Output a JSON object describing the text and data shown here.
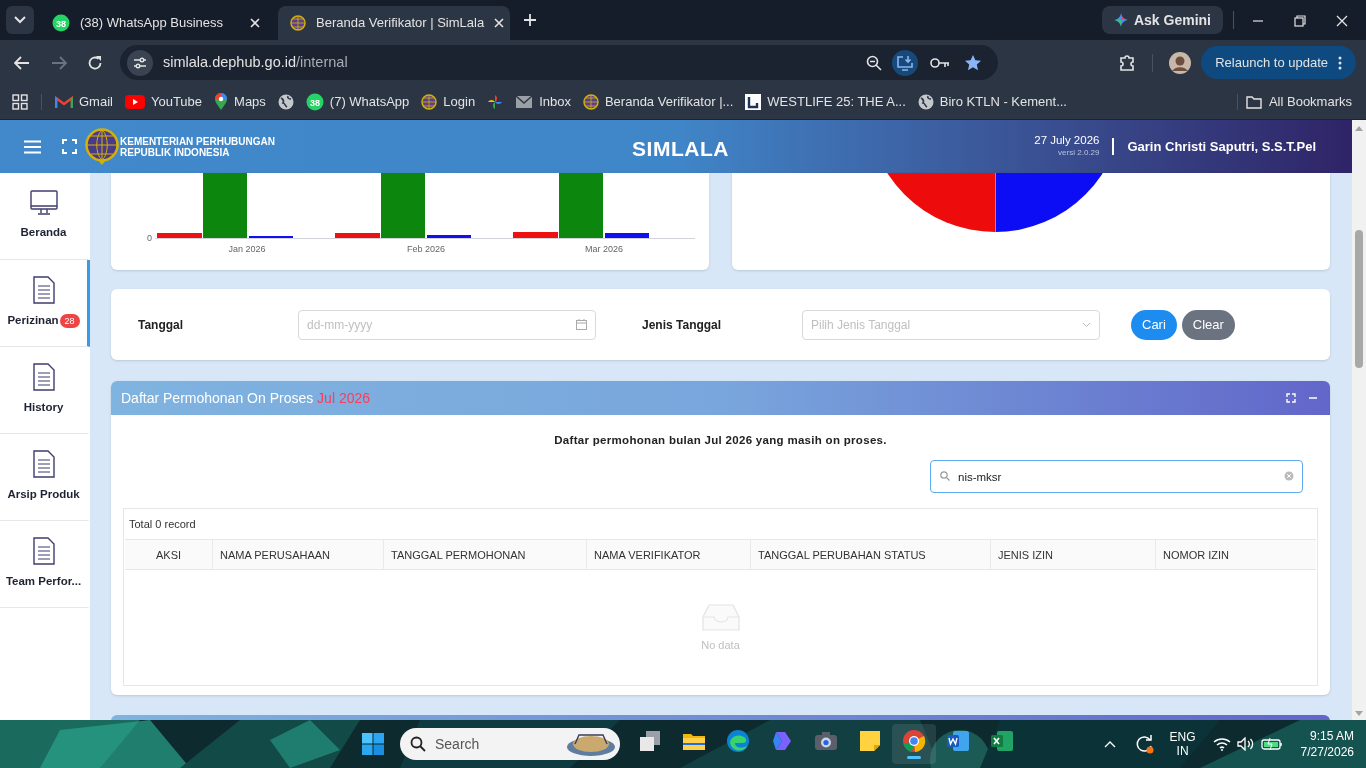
{
  "browser": {
    "tabs": [
      {
        "title": "(38) WhatsApp Business",
        "kind": "whatsapp",
        "badge": "38",
        "selected": false
      },
      {
        "title": "Beranda Verifikator | SimLala",
        "kind": "simlala",
        "selected": true
      }
    ],
    "ask_gemini": "Ask Gemini",
    "url_host": "simlala.dephub.go.id",
    "url_path": "/internal",
    "relaunch": "Relaunch to update",
    "bookmarks": [
      {
        "label": "Gmail",
        "kind": "gmail"
      },
      {
        "label": "YouTube",
        "kind": "youtube"
      },
      {
        "label": "Maps",
        "kind": "maps"
      },
      {
        "kind": "globe"
      },
      {
        "label": "(7) WhatsApp",
        "kind": "whatsapp",
        "badge": "38"
      },
      {
        "label": "Login",
        "kind": "simlala"
      },
      {
        "kind": "pinwheel"
      },
      {
        "label": "Inbox",
        "kind": "mail"
      },
      {
        "label": "Beranda Verifikator |...",
        "kind": "simlala"
      },
      {
        "label": "WESTLIFE 25: THE A...",
        "kind": "square"
      },
      {
        "label": "Biro KTLN - Kement...",
        "kind": "globe"
      }
    ],
    "all_bookmarks": "All Bookmarks"
  },
  "header": {
    "org_line1": "KEMENTERIAN PERHUBUNGAN",
    "org_line2": "REPUBLIK INDONESIA",
    "title": "SIMLALA",
    "date": "27 July 2026",
    "version": "versi 2.0.29",
    "user": "Garin Christi Saputri, S.S.T.Pel"
  },
  "sidebar": [
    {
      "label": "Beranda",
      "kind": "monitor",
      "selected": false
    },
    {
      "label": "Perizinan",
      "kind": "document",
      "badge": "28",
      "selected": true
    },
    {
      "label": "History",
      "kind": "document",
      "selected": false
    },
    {
      "label": "Arsip Produk",
      "kind": "document",
      "selected": false
    },
    {
      "label": "Team Perfor...",
      "kind": "document",
      "selected": false
    }
  ],
  "bar_chart": {
    "y_zero": "0",
    "categories": [
      "Jan 2026",
      "Feb 2026",
      "Mar 2026"
    ]
  },
  "filter": {
    "date_label": "Tanggal",
    "date_placeholder": "dd-mm-yyyy",
    "type_label": "Jenis Tanggal",
    "type_placeholder": "Pilih Jenis Tanggal",
    "search_button": "Cari",
    "clear_button": "Clear"
  },
  "panel": {
    "title": "Daftar Permohonan On Proses",
    "title_period": "Jul 2026",
    "description": "Daftar permohonan bulan Jul 2026 yang masih on proses.",
    "search_value": "nis-mksr",
    "total": "Total 0 record",
    "columns": [
      "AKSI",
      "NAMA PERUSAHAAN",
      "TANGGAL PERMOHONAN",
      "NAMA VERIFIKATOR",
      "TANGGAL PERUBAHAN STATUS",
      "JENIS IZIN",
      "NOMOR IZIN"
    ],
    "empty": "No data"
  },
  "taskbar": {
    "search": "Search",
    "lang": "ENG",
    "region": "IN",
    "time": "9:15 AM",
    "date": "7/27/2026",
    "apps": [
      {
        "kind": "taskview",
        "active": false
      },
      {
        "kind": "folder",
        "active": false
      },
      {
        "kind": "edge",
        "active": false
      },
      {
        "kind": "copilot",
        "active": false
      },
      {
        "kind": "camera",
        "active": false
      },
      {
        "kind": "notes",
        "active": false
      },
      {
        "kind": "chrome",
        "active": true
      },
      {
        "kind": "word",
        "active": false
      },
      {
        "kind": "excel",
        "active": false
      }
    ]
  }
}
